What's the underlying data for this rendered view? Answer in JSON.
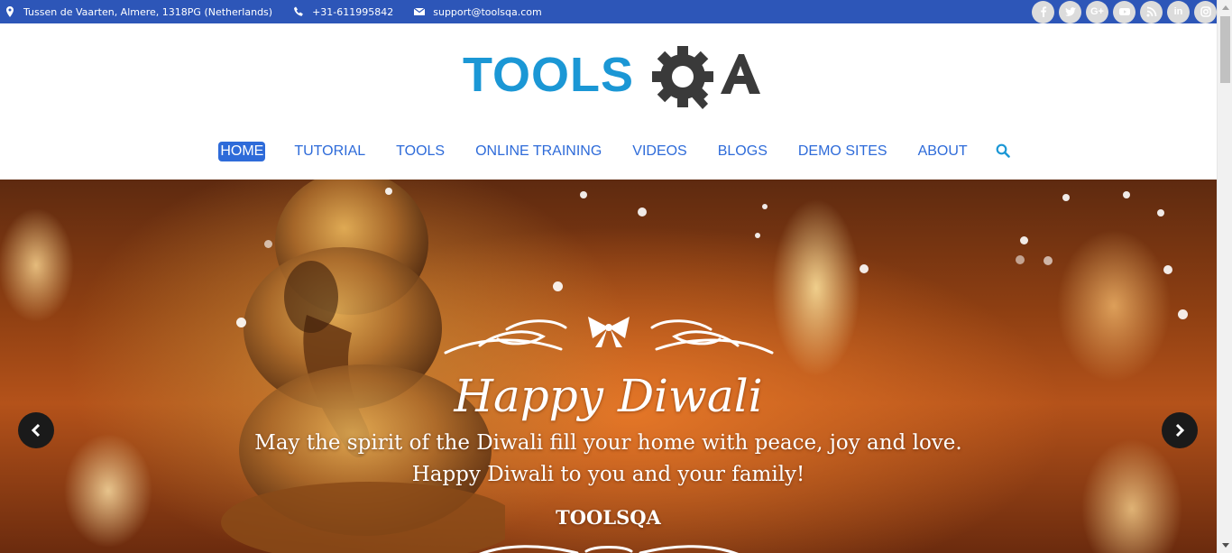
{
  "topbar": {
    "address": "Tussen de Vaarten, Almere, 1318PG (Netherlands)",
    "phone": "+31-611995842",
    "email": "support@toolsqa.com",
    "address_icon": "map-marker-icon",
    "phone_icon": "phone-icon",
    "email_icon": "envelope-icon",
    "social": [
      "facebook-icon",
      "twitter-icon",
      "google-plus-icon",
      "youtube-icon",
      "rss-icon",
      "linkedin-icon",
      "instagram-icon"
    ]
  },
  "logo": {
    "text_tools": "TOOLS",
    "text_qa": "QA",
    "colors": {
      "tools": "#1b97d5",
      "qa": "#3a3a3a"
    }
  },
  "nav": {
    "items": [
      {
        "label": "HOME",
        "active": true
      },
      {
        "label": "TUTORIAL"
      },
      {
        "label": "TOOLS"
      },
      {
        "label": "ONLINE TRAINING"
      },
      {
        "label": "VIDEOS"
      },
      {
        "label": "BLOGS"
      },
      {
        "label": "DEMO SITES"
      },
      {
        "label": "ABOUT"
      }
    ],
    "search_icon": "search-icon",
    "accent": "#2e6bd9"
  },
  "hero": {
    "title": "Happy Diwali",
    "line1": "May the spirit of the Diwali fill your home with peace, joy and love.",
    "line2": "Happy Diwali to you and your family!",
    "brand": "TOOLSQA",
    "prev_icon": "chevron-left-icon",
    "next_icon": "chevron-right-icon"
  },
  "colors": {
    "topbar_bg": "#2d56b8"
  }
}
